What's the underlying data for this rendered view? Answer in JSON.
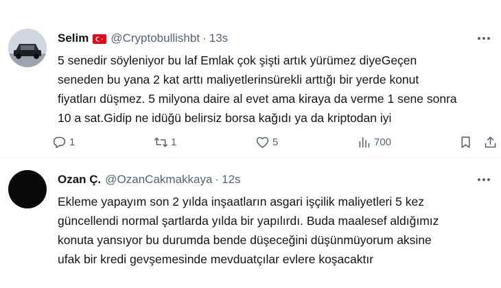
{
  "tweets": [
    {
      "name": "Selim",
      "handle": "@Cryptobullishbt",
      "separator": "·",
      "time": "13s",
      "lines": [
        "5 senedir söyleniyor bu laf Emlak çok şişti artık yürümez diyeGeçen",
        "seneden bu yana 2 kat arttı maliyetlerinsürekli arttığı bir yerde konut",
        "fiyatları düşmez. 5 milyona daire al evet ama kiraya da verme 1 sene sonra",
        "10 a sat.Gidip ne idüğü belirsiz borsa kağıdı ya da kriptodan iyi"
      ],
      "actions": {
        "reply_count": "1",
        "retweet_count": "1",
        "like_count": "5",
        "view_count": "700"
      }
    },
    {
      "name": "Ozan Ç.",
      "handle": "@OzanCakmakkaya",
      "separator": "·",
      "time": "12s",
      "lines": [
        "Ekleme yapayım son 2 yılda inşaatların asgari işçilik maliyetleri 5 kez",
        "güncellendi normal şartlarda yılda bir yapılırdı. Buda maalesef aldığımız",
        "konuta yansıyor bu durumda bende düşeceğini düşünmüyorum aksine",
        "ufak bir kredi gevşemesinde mevduatçılar evlere koşacaktır"
      ]
    }
  ],
  "icons": {
    "flag": "turkey-flag-icon",
    "more": "more-icon",
    "reply": "reply-icon",
    "retweet": "retweet-icon",
    "like": "like-icon",
    "views": "views-icon",
    "bookmark": "bookmark-icon",
    "share": "share-icon"
  },
  "colors": {
    "text": "#0f1419",
    "secondary": "#536471",
    "flag_red": "#e30a17",
    "divider": "#eff3f4"
  }
}
